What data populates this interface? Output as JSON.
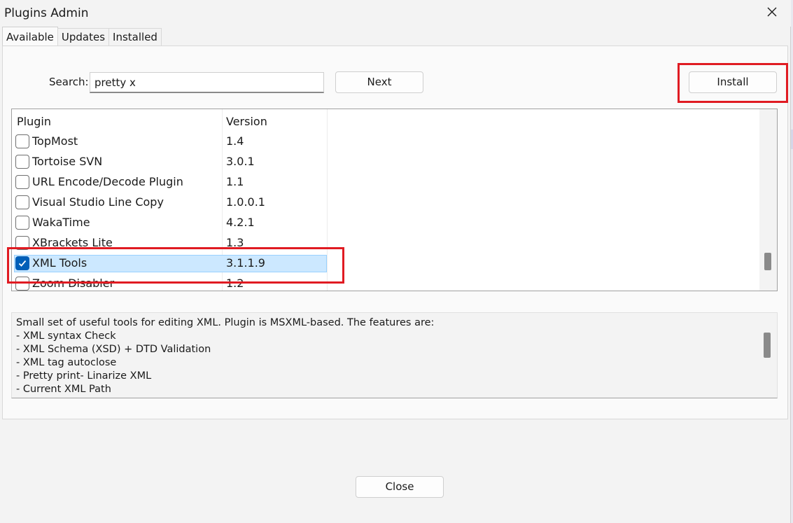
{
  "window": {
    "title": "Plugins Admin",
    "close_glyph": "✕"
  },
  "tabs": [
    {
      "label": "Available",
      "active": true
    },
    {
      "label": "Updates",
      "active": false
    },
    {
      "label": "Installed",
      "active": false
    }
  ],
  "search": {
    "label": "Search:",
    "value": "pretty x",
    "next_label": "Next"
  },
  "install_label": "Install",
  "list": {
    "columns": [
      "Plugin",
      "Version"
    ],
    "rows": [
      {
        "name": "TopMost",
        "version": "1.4",
        "checked": false,
        "selected": false
      },
      {
        "name": "Tortoise SVN",
        "version": "3.0.1",
        "checked": false,
        "selected": false
      },
      {
        "name": "URL Encode/Decode Plugin",
        "version": "1.1",
        "checked": false,
        "selected": false
      },
      {
        "name": "Visual Studio Line Copy",
        "version": "1.0.0.1",
        "checked": false,
        "selected": false
      },
      {
        "name": "WakaTime",
        "version": "4.2.1",
        "checked": false,
        "selected": false
      },
      {
        "name": "XBrackets Lite",
        "version": "1.3",
        "checked": false,
        "selected": false
      },
      {
        "name": "XML Tools",
        "version": "3.1.1.9",
        "checked": true,
        "selected": true
      },
      {
        "name": "Zoom Disabler",
        "version": "1.2",
        "checked": false,
        "selected": false
      }
    ]
  },
  "description": {
    "lines": [
      "Small set of useful tools for editing XML. Plugin is MSXML-based. The features are:",
      "- XML syntax Check",
      "- XML Schema (XSD) + DTD Validation",
      "- XML tag autoclose",
      "- Pretty print- Linarize XML",
      "- Current XML Path"
    ]
  },
  "close_label": "Close",
  "colors": {
    "highlight_box": "#e01b22",
    "selection": "#cce8ff",
    "checkbox_checked": "#005fb8"
  }
}
